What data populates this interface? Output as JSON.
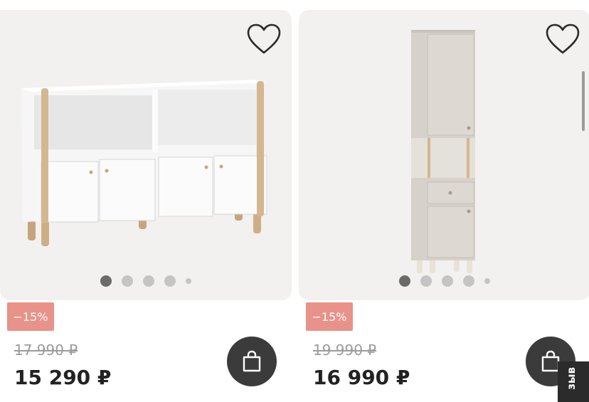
{
  "products": [
    {
      "discount": "−15%",
      "old_price": "17 990 ₽",
      "price": "15 290 ₽",
      "active_dot": 0
    },
    {
      "discount": "−15%",
      "old_price": "19 990 ₽",
      "price": "16 990 ₽",
      "active_dot": 0
    }
  ],
  "feedback_tab": "зыв",
  "colors": {
    "image_bg": "#f2f1ef",
    "badge": "#e8928a",
    "cart_button": "#3b3b3b",
    "price": "#222222",
    "old_price": "#9b9b9b"
  },
  "icons": [
    "heart-icon",
    "shopping-bag-icon"
  ]
}
